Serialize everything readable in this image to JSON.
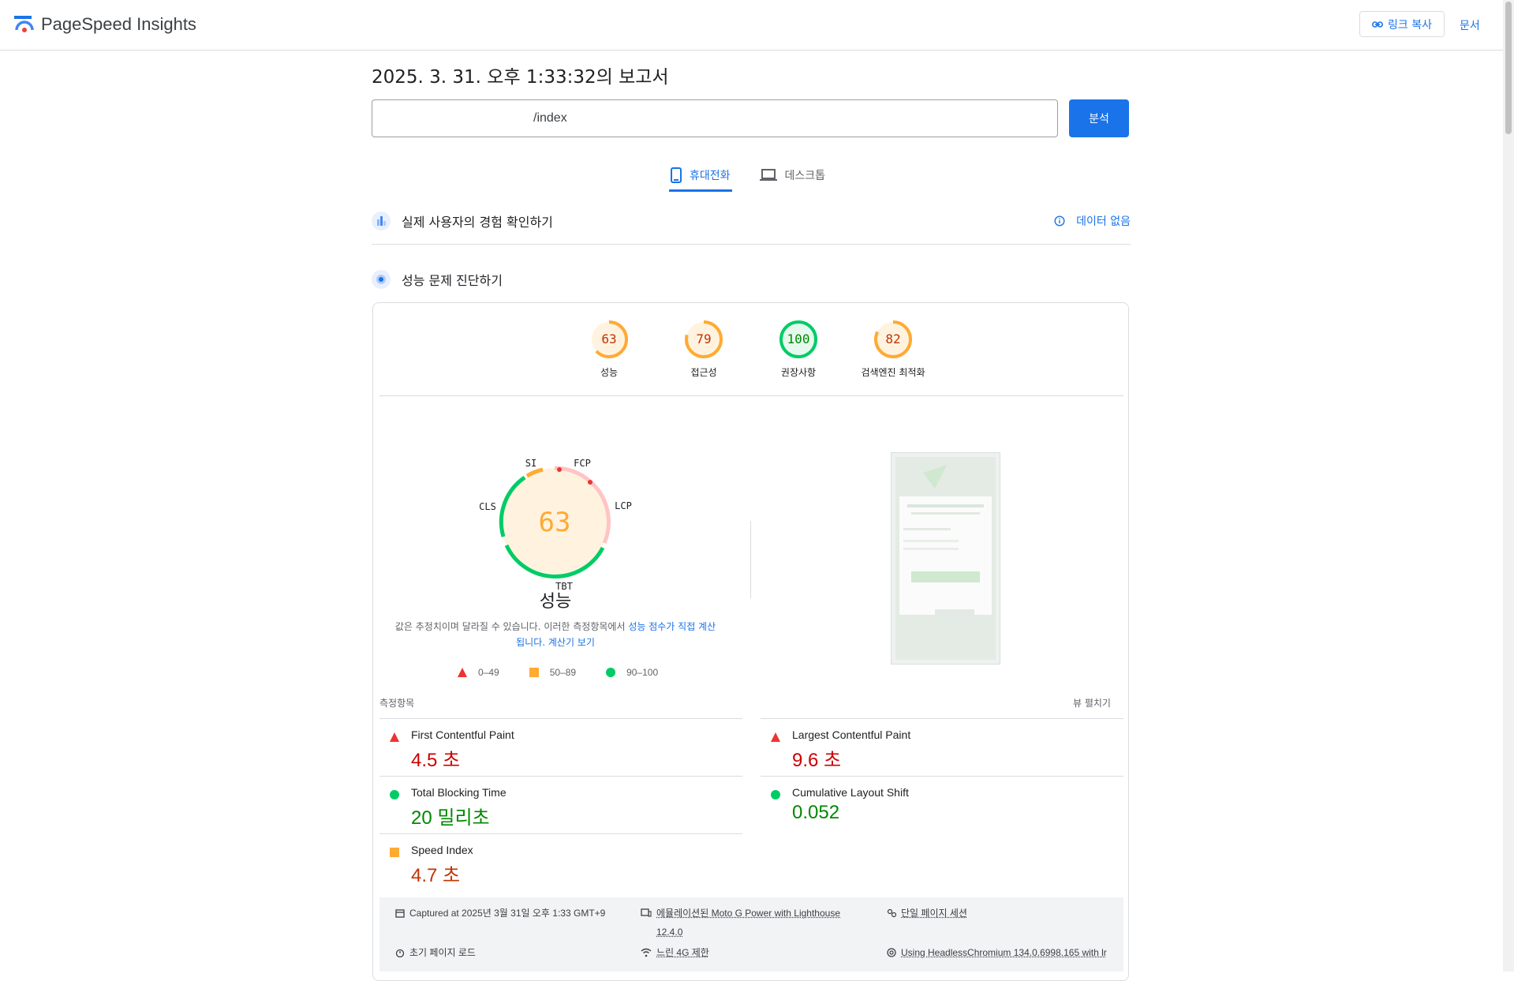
{
  "header": {
    "app_name": "PageSpeed Insights",
    "copy_link": "링크 복사",
    "docs": "문서"
  },
  "report": {
    "title": "2025. 3. 31. 오후 1:33:32의 보고서",
    "url": "/index",
    "analyze": "분석"
  },
  "tabs": [
    {
      "label": "휴대전화",
      "active": true
    },
    {
      "label": "데스크톱",
      "active": false
    }
  ],
  "sections": {
    "field_data": "실제 사용자의 경험 확인하기",
    "no_data": "데이터 없음",
    "diagnose": "성능 문제 진단하기"
  },
  "scores": [
    {
      "value": "63",
      "label": "성능",
      "color": "#fa3"
    },
    {
      "value": "79",
      "label": "접근성",
      "color": "#fa3"
    },
    {
      "value": "100",
      "label": "권장사항",
      "color": "#0c6"
    },
    {
      "value": "82",
      "label": "검색엔진 최적화",
      "color": "#fa3"
    }
  ],
  "perf_gauge": {
    "score": "63",
    "label": "성능",
    "metric_labels": {
      "si": "SI",
      "fcp": "FCP",
      "lcp": "LCP",
      "tbt": "TBT",
      "cls": "CLS"
    }
  },
  "note": {
    "text": "값은 추정치이며 달라질 수 있습니다. 이러한 측정항목에서 ",
    "link1": "성능 점수가 직접 계산됩니다.",
    "link2": "계산기 보기"
  },
  "legend": {
    "red": "0–49",
    "orange": "50–89",
    "green": "90–100"
  },
  "metrics": {
    "title": "측정항목",
    "expand": "뷰 펼치기",
    "items": [
      {
        "name": "First Contentful Paint",
        "value": "4.5 초",
        "status": "fail"
      },
      {
        "name": "Largest Contentful Paint",
        "value": "9.6 초",
        "status": "fail"
      },
      {
        "name": "Total Blocking Time",
        "value": "20 밀리초",
        "status": "pass"
      },
      {
        "name": "Cumulative Layout Shift",
        "value": "0.052",
        "status": "pass"
      },
      {
        "name": "Speed Index",
        "value": "4.7 초",
        "status": "average"
      }
    ]
  },
  "footer": {
    "captured": "Captured at 2025년 3월 31일 오후 1:33 GMT+9",
    "emulated": "에뮬레이션된 Moto G Power with Lighthouse",
    "version": "12.4.0",
    "session": "단일 페이지 세션",
    "load": "초기 페이지 로드",
    "throttle": "느린 4G 제한",
    "browser": "Using HeadlessChromium 134.0.6998.165 with lr"
  },
  "colors": {
    "fail": "#c00",
    "average": "#c33300",
    "pass": "#080",
    "accent": "#1a73e8"
  }
}
